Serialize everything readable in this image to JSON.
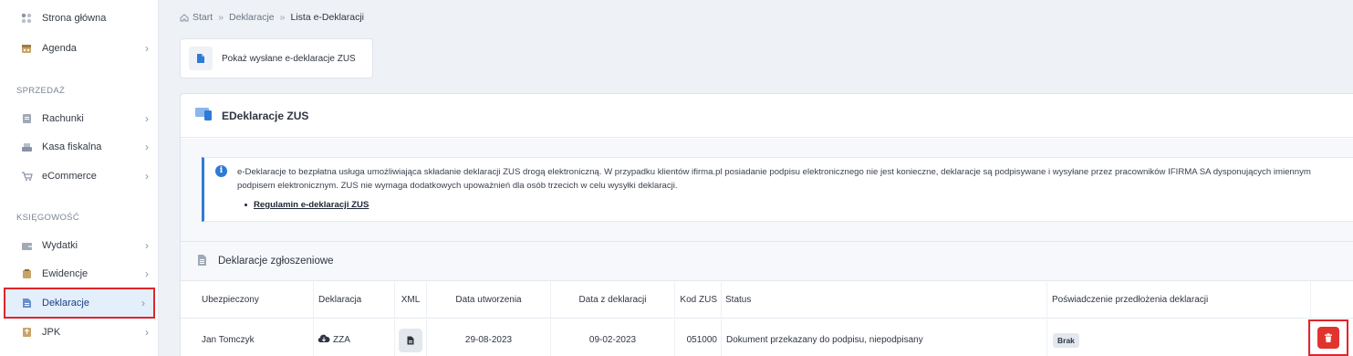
{
  "sidebar": {
    "items": [
      {
        "label": "Strona główna"
      },
      {
        "label": "Agenda"
      },
      {
        "label": "Rachunki"
      },
      {
        "label": "Kasa fiskalna"
      },
      {
        "label": "eCommerce"
      },
      {
        "label": "Wydatki"
      },
      {
        "label": "Ewidencje"
      },
      {
        "label": "Deklaracje"
      },
      {
        "label": "JPK"
      }
    ],
    "sections": [
      "SPRZEDAŻ",
      "KSIĘGOWOŚĆ"
    ],
    "chevron": "›"
  },
  "breadcrumb": [
    "Start",
    "Deklaracje",
    "Lista e-Deklaracji"
  ],
  "breadcrumb_sep": "»",
  "action_button": {
    "label": "Pokaż wysłane e-deklaracje ZUS"
  },
  "panel": {
    "title": "EDeklaracje ZUS",
    "info_icon": "i",
    "info_text": "e-Deklaracje to bezpłatna usługa umożliwiająca składanie deklaracji ZUS drogą elektroniczną. W przypadku klientów ifirma.pl posiadanie podpisu elektronicznego nie jest konieczne, deklaracje są podpisywane i wysyłane przez pracowników IFIRMA SA dysponujących imiennym podpisem elektronicznym. ZUS nie wymaga dodatkowych upoważnień dla osób trzecich w celu wysyłki deklaracji.",
    "info_link": "Regulamin e-deklaracji ZUS",
    "subheader": "Deklaracje zgłoszeniowe"
  },
  "table": {
    "headers": [
      "Ubezpieczony",
      "Deklaracja",
      "XML",
      "Data utworzenia",
      "Data z deklaracji",
      "Kod ZUS",
      "Status",
      "Poświadczenie przedłożenia deklaracji"
    ],
    "rows": [
      {
        "ubezpieczony": "Jan Tomczyk",
        "deklaracja": "ZZA",
        "data_utworzenia": "29-08-2023",
        "data_z_deklaracji": "09-02-2023",
        "kod_zus": "051000",
        "status": "Dokument przekazany do podpisu, niepodpisany",
        "poswiadczenie": "Brak"
      }
    ]
  },
  "colors": {
    "accent": "#2e7bd6",
    "danger": "#e0352e",
    "highlight": "#e0252b"
  }
}
